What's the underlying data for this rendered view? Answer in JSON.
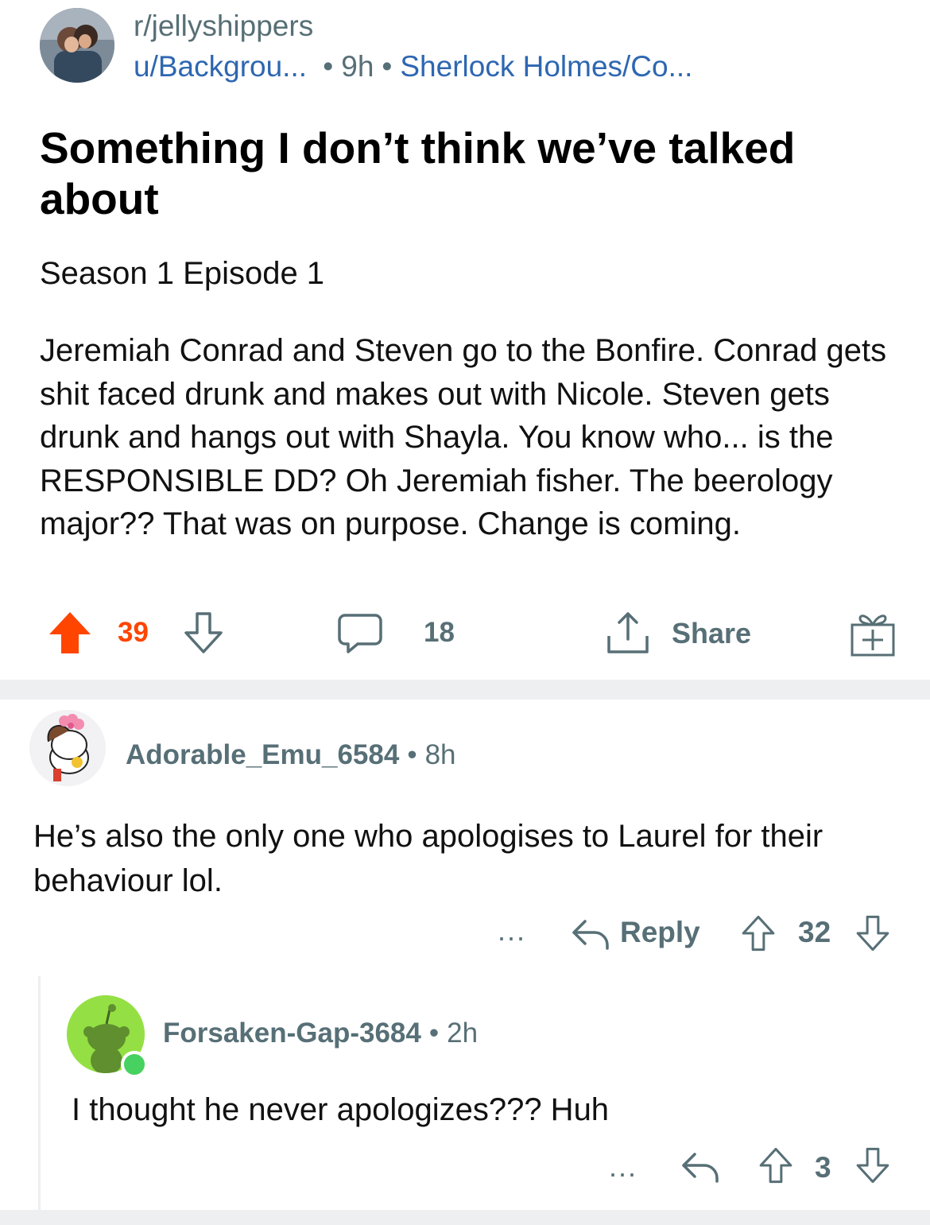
{
  "post": {
    "subreddit": "r/jellyshippers",
    "author": "u/Backgrou...",
    "age": "9h",
    "flair": "Sherlock Holmes/Co...",
    "title": "Something I don’t think we’ve talked about",
    "subhead": "Season 1 Episode 1",
    "body": "Jeremiah Conrad and Steven go to the Bonfire. Conrad gets shit faced drunk and makes out with Nicole. Steven gets drunk and hangs out with Shayla. You know who... is the RESPONSIBLE DD? Oh Jeremiah fisher. The beerology major?? That was on purpose. Change is coming.",
    "votes": "39",
    "comments": "18",
    "share_label": "Share"
  },
  "comments": [
    {
      "author": "Adorable_Emu_6584",
      "age": "8h",
      "body": "He’s also the only one who apologises to Laurel for their behaviour lol.",
      "more": "...",
      "reply_label": "Reply",
      "score": "32"
    },
    {
      "author": "Forsaken-Gap-3684",
      "age": "2h",
      "body": "I thought he never apologizes??? Huh",
      "more": "...",
      "score": "3"
    }
  ],
  "colors": {
    "upvoted": "#ff4500",
    "muted": "#576f76",
    "link": "#2e67b1",
    "divider": "#edeff1",
    "online": "#46d160"
  },
  "icons": {
    "upvote": "arrow-up-filled-icon",
    "downvote": "arrow-down-outline-icon",
    "comment": "speech-bubble-icon",
    "share": "share-upload-icon",
    "award": "gift-icon",
    "reply": "reply-arrow-icon"
  }
}
